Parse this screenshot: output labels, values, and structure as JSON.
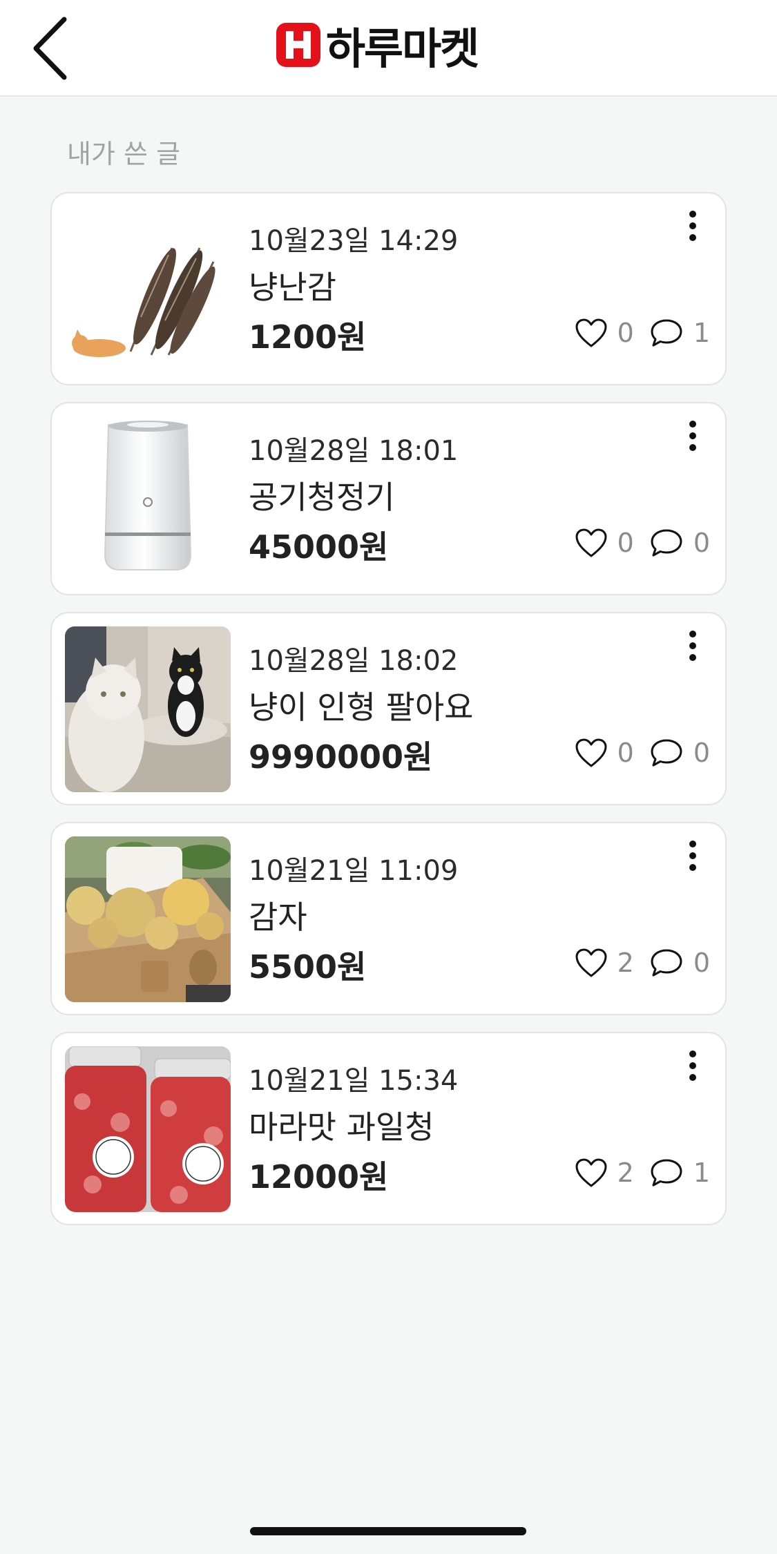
{
  "header": {
    "back_icon": "chevron-left-icon",
    "logo_badge": "H",
    "logo_text": "하루마켓",
    "brand_color": "#e4111b"
  },
  "section": {
    "title": "내가 쓴 글"
  },
  "posts": [
    {
      "date": "10월23일 14:29",
      "title": "냥난감",
      "price": "1200원",
      "likes": "0",
      "comments": "1",
      "image": "pheasant-feather-cat-toy"
    },
    {
      "date": "10월28일 18:01",
      "title": "공기청정기",
      "price": "45000원",
      "likes": "0",
      "comments": "0",
      "image": "white-air-purifier"
    },
    {
      "date": "10월28일 18:02",
      "title": "냥이 인형 팔아요",
      "price": "9990000원",
      "likes": "0",
      "comments": "0",
      "image": "persian-and-tuxedo-cats"
    },
    {
      "date": "10월21일 11:09",
      "title": "감자",
      "price": "5500원",
      "likes": "2",
      "comments": "0",
      "image": "potatoes-in-box"
    },
    {
      "date": "10월21일 15:34",
      "title": "마라맛 과일청",
      "price": "12000원",
      "likes": "2",
      "comments": "1",
      "image": "fruit-syrup-jars"
    }
  ]
}
